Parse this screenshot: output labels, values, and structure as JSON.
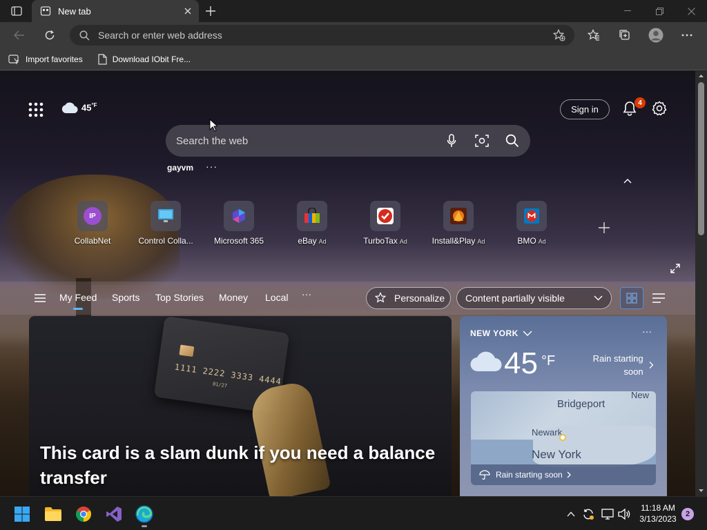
{
  "browser": {
    "tab": {
      "title": "New tab"
    },
    "address": {
      "placeholder": "Search or enter web address"
    },
    "favorites": [
      {
        "label": "Import favorites",
        "icon": "import-favorites-icon"
      },
      {
        "label": "Download IObit Fre...",
        "icon": "page-icon"
      }
    ]
  },
  "newtab": {
    "weather_mini": {
      "temp": "45",
      "unit": "°F"
    },
    "signin_label": "Sign in",
    "notification_count": "4",
    "search_placeholder": "Search the web",
    "user": {
      "name": "gayvm",
      "more": "···"
    },
    "quick_links": [
      {
        "label": "CollabNet",
        "ad": "",
        "icon_text": "IP"
      },
      {
        "label": "Control Colla...",
        "ad": "",
        "icon_text": ""
      },
      {
        "label": "Microsoft 365",
        "ad": "",
        "icon_text": ""
      },
      {
        "label": "eBay",
        "ad": "Ad",
        "icon_text": ""
      },
      {
        "label": "TurboTax",
        "ad": "Ad",
        "icon_text": ""
      },
      {
        "label": "Install&Play",
        "ad": "Ad",
        "icon_text": ""
      },
      {
        "label": "BMO",
        "ad": "Ad",
        "icon_text": ""
      }
    ],
    "feed_tabs": [
      "My Feed",
      "Sports",
      "Top Stories",
      "Money",
      "Local"
    ],
    "feed_more": "···",
    "personalize_label": "Personalize",
    "visibility_label": "Content partially visible",
    "hero": {
      "title": "This card is a slam dunk if you need a balance transfer",
      "card_number": "1111 2222 3333 4444",
      "card_expiry": "01/27"
    },
    "weather": {
      "location": "NEW YORK",
      "temp": "45",
      "unit": "°F",
      "forecast": "Rain starting soon",
      "map_labels": {
        "bridgeport": "Bridgeport",
        "newark": "Newark",
        "new_york": "New York",
        "new": "New"
      },
      "map_footer": "Rain starting soon",
      "more": "···"
    }
  },
  "taskbar": {
    "time": "11:18 AM",
    "date": "3/13/2023",
    "notifications": "2"
  },
  "colors": {
    "accent": "#5cb8ff",
    "badge": "#d83b01",
    "tray_badge": "#c8a2e8"
  }
}
